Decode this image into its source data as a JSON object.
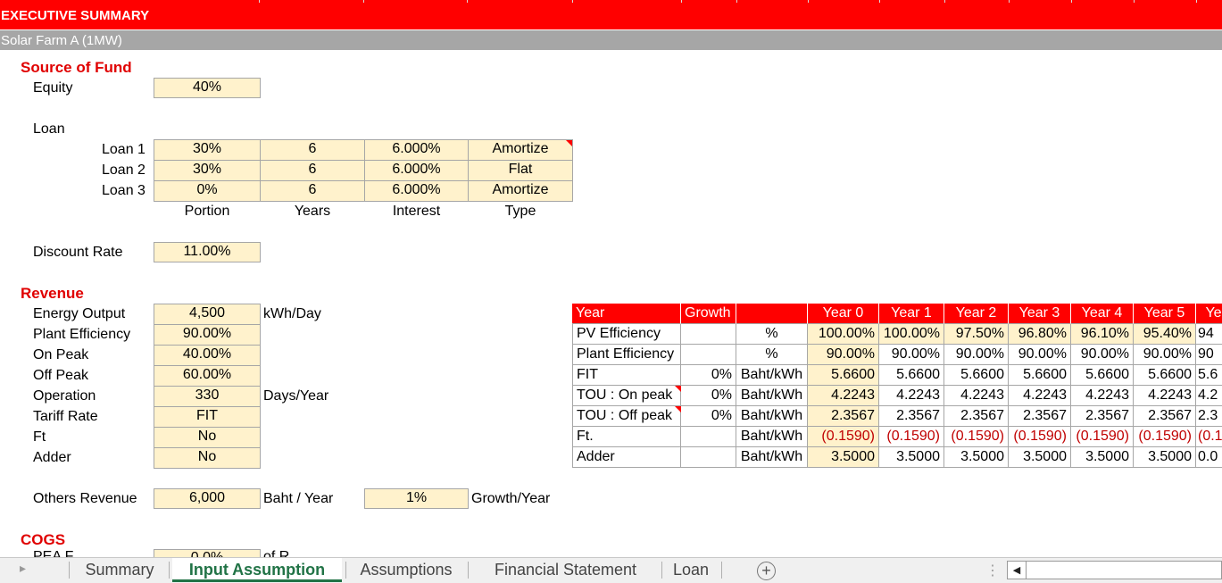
{
  "banner": {
    "title": "EXECUTIVE SUMMARY",
    "subtitle": "Solar Farm A (1MW)"
  },
  "source_of_fund": {
    "heading": "Source of Fund",
    "equity_label": "Equity",
    "equity_value": "40%",
    "loan_label": "Loan",
    "loans": [
      {
        "label": "Loan 1",
        "portion": "30%",
        "years": "6",
        "interest": "6.000%",
        "type": "Amortize"
      },
      {
        "label": "Loan 2",
        "portion": "30%",
        "years": "6",
        "interest": "6.000%",
        "type": "Flat"
      },
      {
        "label": "Loan 3",
        "portion": "0%",
        "years": "6",
        "interest": "6.000%",
        "type": "Amortize"
      }
    ],
    "columns": {
      "portion": "Portion",
      "years": "Years",
      "interest": "Interest",
      "type": "Type"
    },
    "discount_label": "Discount Rate",
    "discount_value": "11.00%"
  },
  "revenue": {
    "heading": "Revenue",
    "rows": [
      {
        "label": "Energy Output",
        "value": "4,500",
        "unit": "kWh/Day"
      },
      {
        "label": "Plant Efficiency",
        "value": "90.00%",
        "unit": ""
      },
      {
        "label": "On Peak",
        "value": "40.00%",
        "unit": ""
      },
      {
        "label": "Off Peak",
        "value": "60.00%",
        "unit": ""
      },
      {
        "label": "Operation",
        "value": "330",
        "unit": "Days/Year"
      },
      {
        "label": "Tariff Rate",
        "value": "FIT",
        "unit": ""
      },
      {
        "label": "Ft",
        "value": "No",
        "unit": ""
      },
      {
        "label": "Adder",
        "value": "No",
        "unit": ""
      }
    ],
    "others_label": "Others Revenue",
    "others_value": "6,000",
    "others_unit": "Baht / Year",
    "others_growth": "1%",
    "others_growth_unit": "Growth/Year"
  },
  "cogs": {
    "heading": "COGS",
    "row_label_partial": "PEA F",
    "row_value_partial": "0.0%",
    "row_unit_partial": "of R"
  },
  "year_table": {
    "headers": [
      "Year",
      "Growth",
      "",
      "Year 0",
      "Year 1",
      "Year 2",
      "Year 3",
      "Year 4",
      "Year 5",
      "Ye"
    ],
    "rows": [
      {
        "label": "PV Efficiency",
        "growth": "",
        "unit": "%",
        "values": [
          "100.00%",
          "100.00%",
          "97.50%",
          "96.80%",
          "96.10%",
          "95.40%",
          "94"
        ]
      },
      {
        "label": "Plant Efficiency",
        "growth": "",
        "unit": "%",
        "values": [
          "90.00%",
          "90.00%",
          "90.00%",
          "90.00%",
          "90.00%",
          "90.00%",
          "90"
        ]
      },
      {
        "label": "FIT",
        "growth": "0%",
        "unit": "Baht/kWh",
        "values": [
          "5.6600",
          "5.6600",
          "5.6600",
          "5.6600",
          "5.6600",
          "5.6600",
          "5.6"
        ]
      },
      {
        "label": "TOU : On peak",
        "growth": "0%",
        "unit": "Baht/kWh",
        "values": [
          "4.2243",
          "4.2243",
          "4.2243",
          "4.2243",
          "4.2243",
          "4.2243",
          "4.2"
        ]
      },
      {
        "label": "TOU : Off peak",
        "growth": "0%",
        "unit": "Baht/kWh",
        "values": [
          "2.3567",
          "2.3567",
          "2.3567",
          "2.3567",
          "2.3567",
          "2.3567",
          "2.3"
        ]
      },
      {
        "label": "Ft.",
        "growth": "",
        "unit": "Baht/kWh",
        "values": [
          "(0.1590)",
          "(0.1590)",
          "(0.1590)",
          "(0.1590)",
          "(0.1590)",
          "(0.1590)",
          "(0.1"
        ]
      },
      {
        "label": "Adder",
        "growth": "",
        "unit": "Baht/kWh",
        "values": [
          "3.5000",
          "3.5000",
          "3.5000",
          "3.5000",
          "3.5000",
          "3.5000",
          "0.0"
        ]
      }
    ]
  },
  "sheet_tabs": {
    "tabs": [
      "Summary",
      "Input Assumption",
      "Assumptions",
      "Financial Statement",
      "Loan"
    ],
    "active": "Input Assumption",
    "add_symbol": "+",
    "scroll_left_symbol": "◀",
    "nav_symbol": "▸",
    "menu_symbol": "⋮"
  },
  "colors": {
    "banner": "#ff0000",
    "subbar": "#a6a6a6",
    "input_fill": "#fff2cc",
    "active_tab": "#217346",
    "negative": "#c00000"
  }
}
